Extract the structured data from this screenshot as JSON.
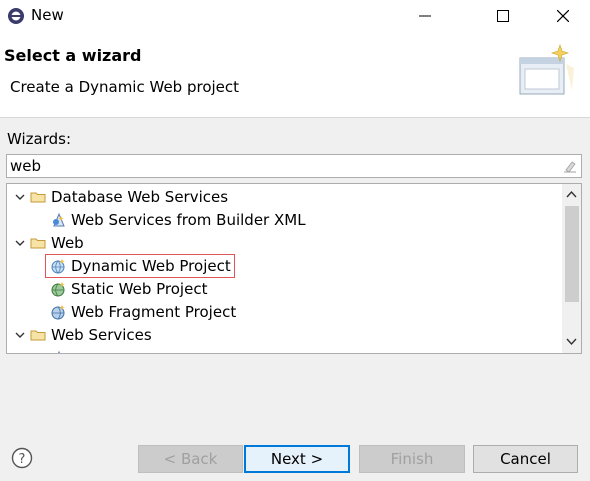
{
  "window": {
    "title": "New"
  },
  "header": {
    "title": "Select a wizard",
    "description": "Create a Dynamic Web project"
  },
  "wizards_label": "Wizards:",
  "filter": {
    "value": "web"
  },
  "tree": {
    "rows": [
      {
        "label": "Database Web Services",
        "expanded": true,
        "type": "folder"
      },
      {
        "label": "Web Services from Builder XML",
        "type": "item"
      },
      {
        "label": "Web",
        "expanded": true,
        "type": "folder"
      },
      {
        "label": "Dynamic Web Project",
        "type": "item",
        "selected": true
      },
      {
        "label": "Static Web Project",
        "type": "item"
      },
      {
        "label": "Web Fragment Project",
        "type": "item"
      },
      {
        "label": "Web Services",
        "expanded": true,
        "type": "folder"
      }
    ]
  },
  "buttons": {
    "back": "< Back",
    "next": "Next >",
    "finish": "Finish",
    "cancel": "Cancel"
  },
  "colors": {
    "selection_outline": "#e05555",
    "default_button_border": "#0078d7"
  }
}
